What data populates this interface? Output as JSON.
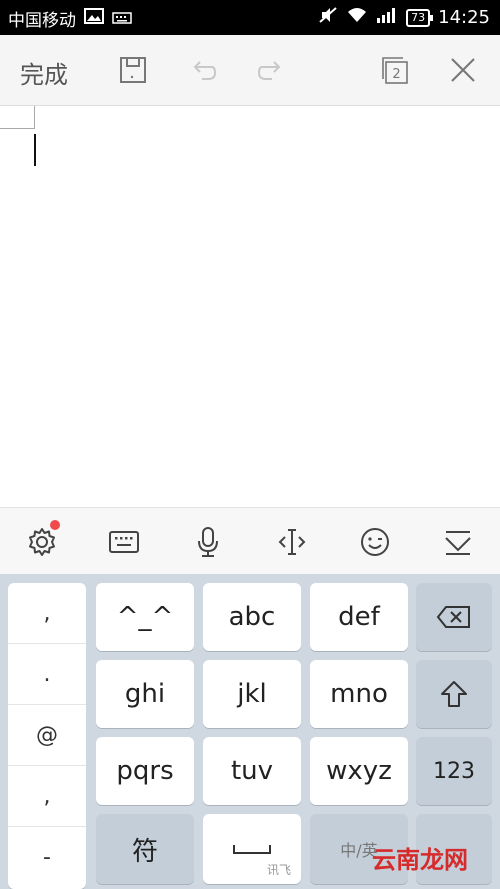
{
  "status_bar": {
    "carrier": "中国移动",
    "battery": "73",
    "time": "14:25"
  },
  "toolbar": {
    "done_label": "完成",
    "pages_count": "2"
  },
  "ime_toolbar": {
    "icons": [
      "gear-icon",
      "keyboard-icon",
      "microphone-icon",
      "cursor-icon",
      "emoji-icon",
      "hide-keyboard-icon"
    ]
  },
  "keyboard": {
    "punctuation": [
      ",",
      ".",
      "@",
      ",",
      "-"
    ],
    "keys": {
      "emoticon": "^_^",
      "abc": "abc",
      "def": "def",
      "ghi": "ghi",
      "jkl": "jkl",
      "mno": "mno",
      "pqrs": "pqrs",
      "tuv": "tuv",
      "wxyz": "wxyz",
      "num": "123",
      "symbol": "符",
      "space_sub": "讯飞",
      "lang_switch": "中/英"
    },
    "watermark": "云南龙网"
  }
}
